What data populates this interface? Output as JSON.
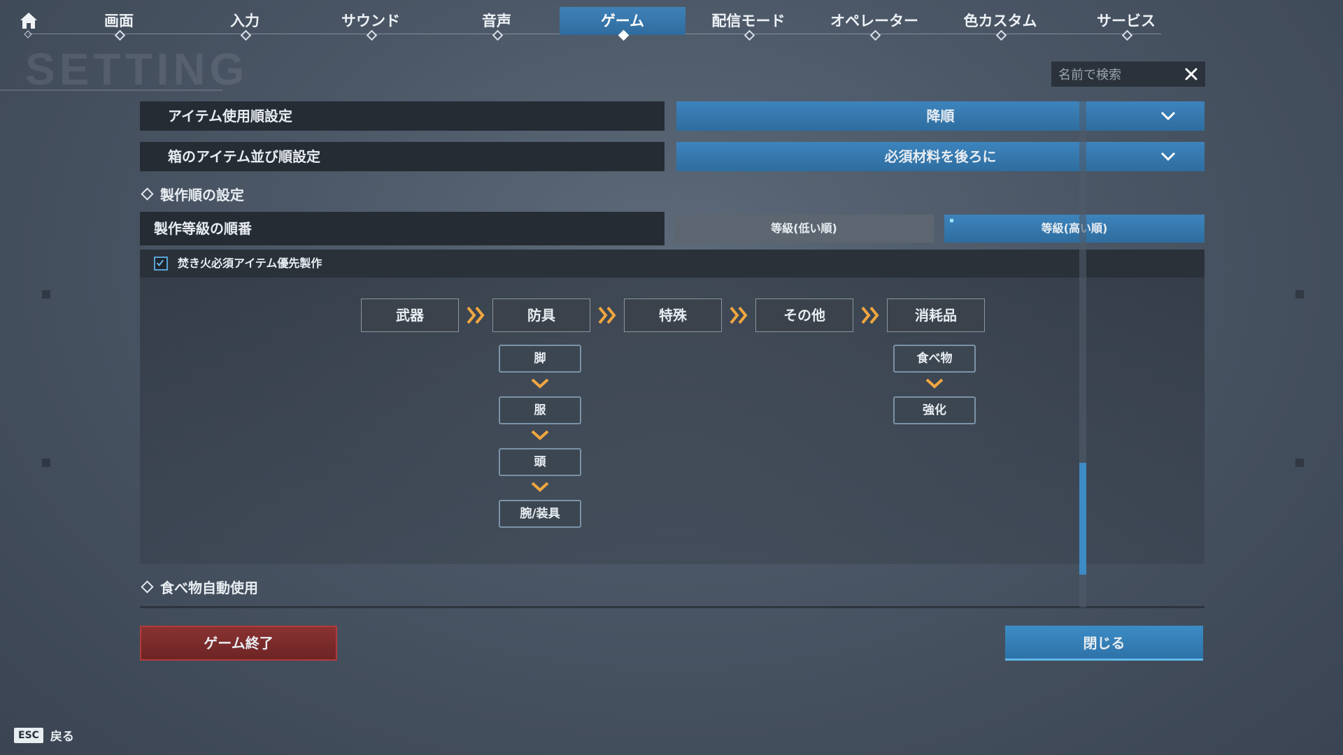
{
  "tabs": [
    {
      "label": "画面"
    },
    {
      "label": "入力"
    },
    {
      "label": "サウンド"
    },
    {
      "label": "音声"
    },
    {
      "label": "ゲーム",
      "active": true
    },
    {
      "label": "配信モード"
    },
    {
      "label": "オペレーター"
    },
    {
      "label": "色カスタム"
    },
    {
      "label": "サービス"
    }
  ],
  "title_watermark": "SETTING",
  "search": {
    "placeholder": "名前で検索"
  },
  "settings": {
    "item_use_order": {
      "label": "アイテム使用順設定",
      "value": "降順"
    },
    "box_sort_order": {
      "label": "箱のアイテム並び順設定",
      "value": "必須材料を後ろに"
    }
  },
  "crafting": {
    "section_title": "製作順の設定",
    "grade_label": "製作等級の順番",
    "grade_low": "等級(低い順)",
    "grade_high": "等級(高い順)",
    "grade_selected": "high",
    "bonfire_checkbox": {
      "label": "焚き火必須アイテム優先製作",
      "checked": true
    },
    "categories": [
      "武器",
      "防具",
      "特殊",
      "その他",
      "消耗品"
    ],
    "armor_order": [
      "脚",
      "服",
      "頭",
      "腕/装具"
    ],
    "consumable_order": [
      "食べ物",
      "強化"
    ]
  },
  "food_auto_use": {
    "section_title": "食べ物自動使用"
  },
  "buttons": {
    "quit": "ゲーム終了",
    "close": "閉じる"
  },
  "footer": {
    "key": "ESC",
    "back": "戻る"
  },
  "colors": {
    "accent": "#3d84bd",
    "arrow": "#f0a640",
    "danger": "#8a3232"
  }
}
